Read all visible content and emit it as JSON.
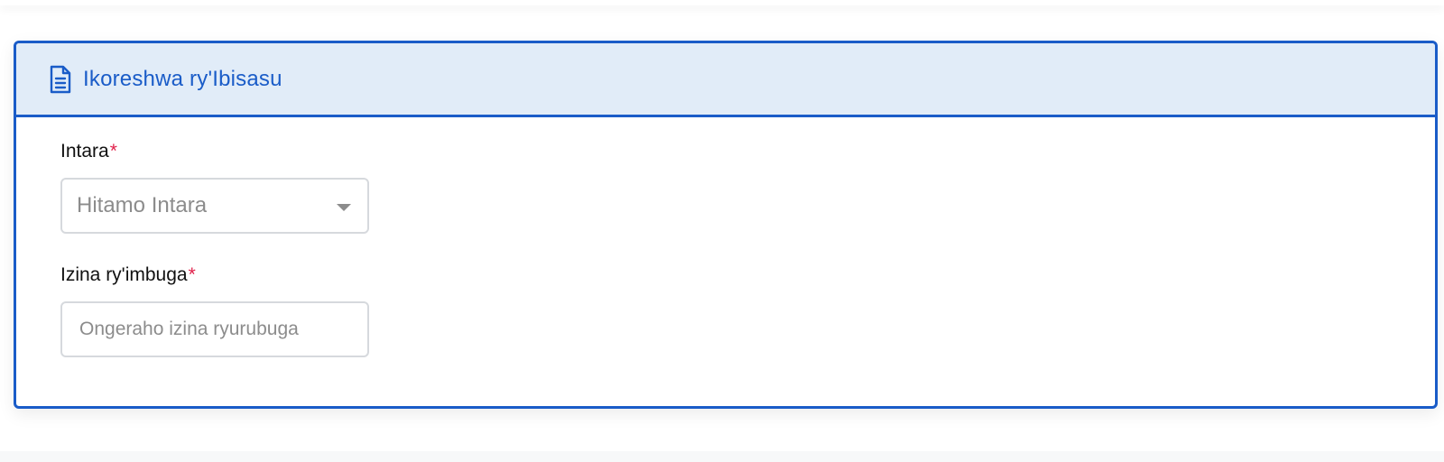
{
  "card": {
    "title": "Ikoreshwa ry'Ibisasu",
    "icon": "document-icon"
  },
  "form": {
    "province": {
      "label": "Intara",
      "required_mark": "*",
      "placeholder": "Hitamo Intara"
    },
    "venue_name": {
      "label": "Izina ry'imbuga",
      "required_mark": "*",
      "placeholder": "Ongeraho izina ryurubuga",
      "value": ""
    }
  },
  "colors": {
    "accent": "#1a5cc8",
    "header_bg": "#e1ecf8",
    "required": "#e0204a",
    "placeholder": "#8c8c8c",
    "input_border": "#d6d9dd"
  }
}
